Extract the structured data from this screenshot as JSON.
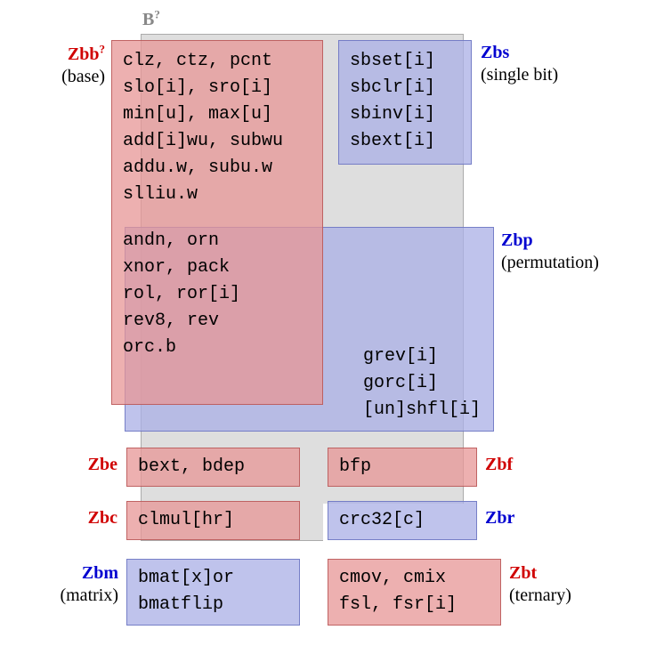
{
  "title": {
    "name": "B",
    "sup": "?"
  },
  "zbb": {
    "name": "Zbb",
    "sup": "?",
    "desc": "(base)",
    "lines": [
      "clz, ctz, pcnt",
      "slo[i], sro[i]",
      "min[u], max[u]",
      "add[i]wu, subwu",
      "addu.w, subu.w",
      "slliu.w"
    ],
    "shared": [
      "andn, orn",
      "xnor, pack",
      "rol, ror[i]",
      "rev8, rev",
      "orc.b"
    ]
  },
  "zbs": {
    "name": "Zbs",
    "desc": "(single bit)",
    "lines": [
      "sbset[i]",
      "sbclr[i]",
      "sbinv[i]",
      "sbext[i]"
    ]
  },
  "zbp": {
    "name": "Zbp",
    "desc": "(permutation)",
    "extra": [
      "grev[i]",
      "gorc[i]",
      "[un]shfl[i]"
    ]
  },
  "zbe": {
    "name": "Zbe",
    "lines": [
      "bext, bdep"
    ]
  },
  "zbf": {
    "name": "Zbf",
    "lines": [
      "bfp"
    ]
  },
  "zbc": {
    "name": "Zbc",
    "lines": [
      "clmul[hr]"
    ]
  },
  "zbr": {
    "name": "Zbr",
    "lines": [
      "crc32[c]"
    ]
  },
  "zbm": {
    "name": "Zbm",
    "desc": "(matrix)",
    "lines": [
      "bmat[x]or",
      "bmatflip"
    ]
  },
  "zbt": {
    "name": "Zbt",
    "desc": "(ternary)",
    "lines": [
      "cmov, cmix",
      "fsl, fsr[i]"
    ]
  }
}
